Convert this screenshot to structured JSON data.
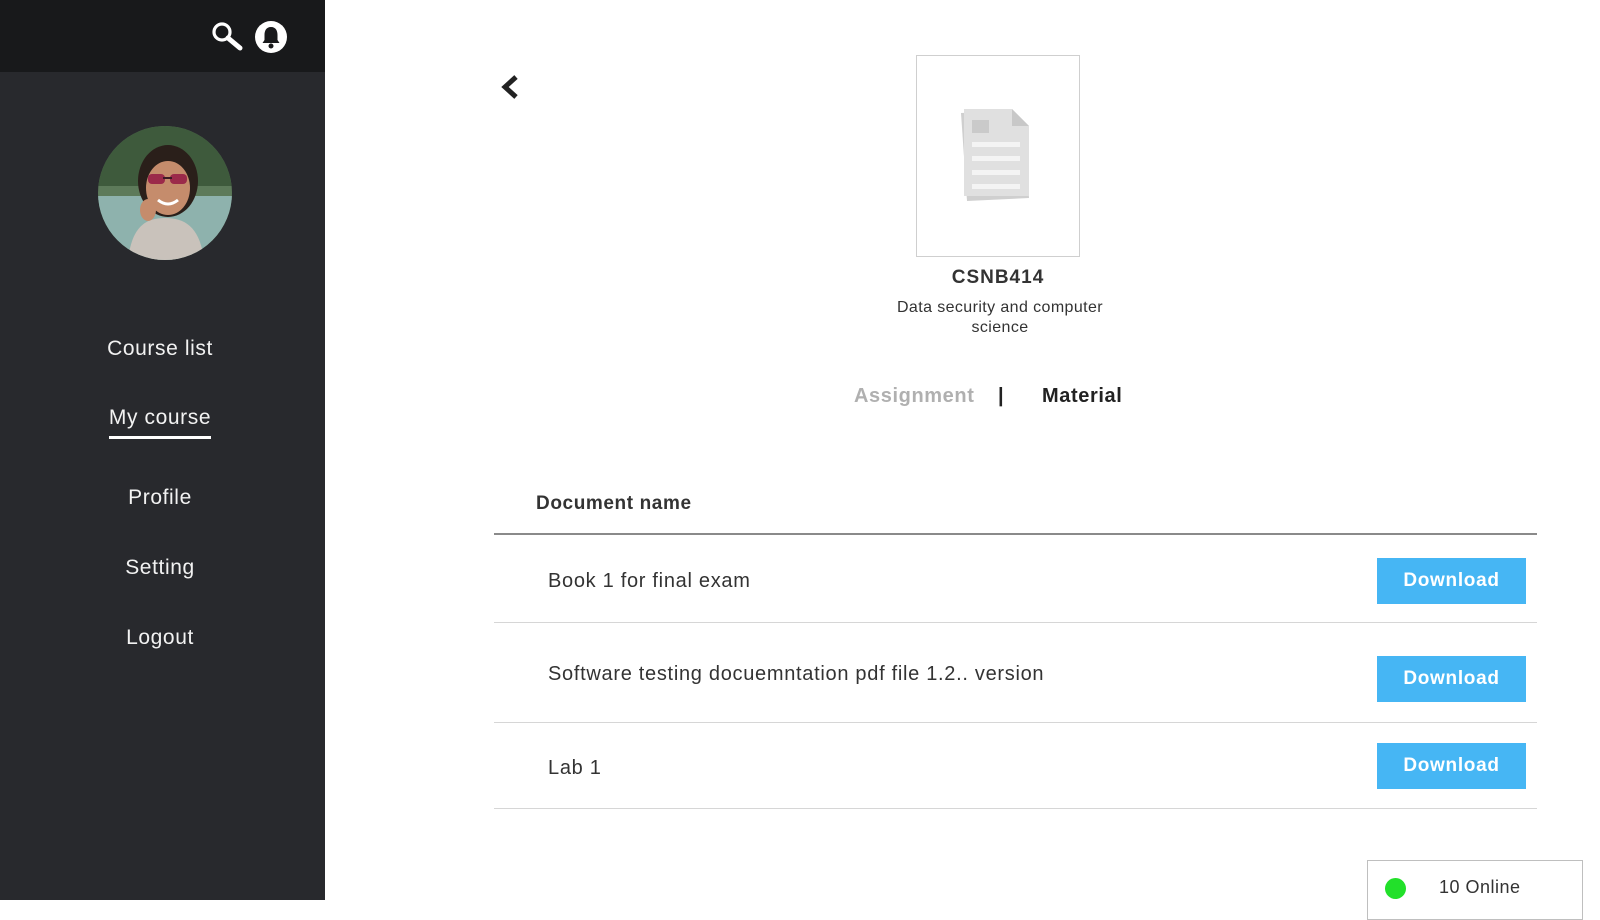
{
  "topbar": {
    "search_icon": "search-icon",
    "notification_icon": "bell-icon"
  },
  "sidebar": {
    "avatar": "avatar",
    "items": [
      {
        "label": "Course list",
        "active": false
      },
      {
        "label": "My course",
        "active": true
      },
      {
        "label": "Profile",
        "active": false
      },
      {
        "label": "Setting",
        "active": false
      },
      {
        "label": "Logout",
        "active": false
      }
    ]
  },
  "course": {
    "code": "CSNB414",
    "name": "Data security and computer science",
    "thumbnail_icon": "document-icon"
  },
  "tabs": {
    "assignment": "Assignment",
    "separator": "|",
    "material": "Material",
    "active": "Material"
  },
  "table": {
    "header": "Document name",
    "rows": [
      {
        "name": "Book 1 for final exam",
        "action": "Download"
      },
      {
        "name": "Software testing docuemntation pdf file 1.2.. version",
        "action": "Download"
      },
      {
        "name": "Lab 1",
        "action": "Download"
      }
    ]
  },
  "status": {
    "online_text": "10 Online"
  },
  "colors": {
    "sidebar_bg": "#28292d",
    "topbar_bg": "#18191b",
    "accent": "#46b6f4",
    "online": "#22e02a"
  }
}
